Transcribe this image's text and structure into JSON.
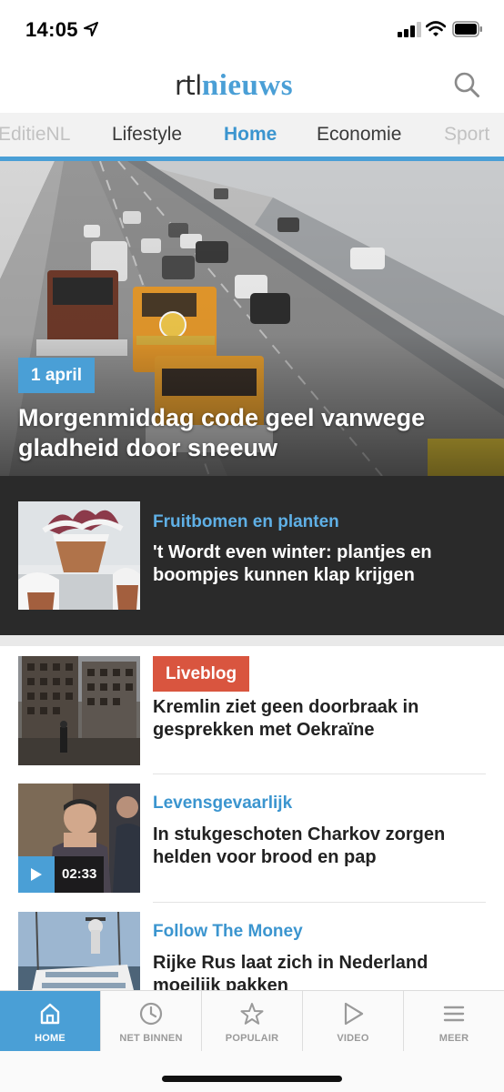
{
  "status_bar": {
    "time": "14:05",
    "icons": [
      "location-arrow-icon",
      "cellular-signal-icon",
      "wifi-icon",
      "battery-icon"
    ]
  },
  "header": {
    "logo_prefix": "rtl",
    "logo_main": "nieuws",
    "search_icon": "search-icon"
  },
  "tabs": [
    {
      "label": "EditieNL",
      "state": "faded"
    },
    {
      "label": "Lifestyle",
      "state": "normal"
    },
    {
      "label": "Home",
      "state": "active"
    },
    {
      "label": "Economie",
      "state": "normal"
    },
    {
      "label": "Sport",
      "state": "faded"
    }
  ],
  "hero": {
    "date": "1 april",
    "title": "Morgenmiddag code geel vanwege gladheid door sneeuw"
  },
  "feature": {
    "category": "Fruitbomen en planten",
    "title": "'t Wordt even winter: plantjes en boompjes kunnen klap krijgen"
  },
  "articles": [
    {
      "badge": "Liveblog",
      "title": "Kremlin ziet geen doorbraak in gesprekken met Oekraïne"
    },
    {
      "category": "Levensgevaarlijk",
      "title": "In stukgeschoten Charkov zorgen helden voor brood en pap",
      "video_duration": "02:33"
    },
    {
      "category": "Follow The Money",
      "title": "Rijke Rus laat zich in Nederland moeilijk pakken"
    }
  ],
  "tabbar": [
    {
      "label": "HOME",
      "icon": "home-icon",
      "active": true
    },
    {
      "label": "NET BINNEN",
      "icon": "clock-icon",
      "active": false
    },
    {
      "label": "POPULAIR",
      "icon": "star-icon",
      "active": false
    },
    {
      "label": "VIDEO",
      "icon": "play-icon",
      "active": false
    },
    {
      "label": "MEER",
      "icon": "menu-icon",
      "active": false
    }
  ],
  "colors": {
    "brand_blue": "#4a9fd6",
    "liveblog_red": "#d9553f",
    "feature_bg": "#2a2a2a"
  }
}
